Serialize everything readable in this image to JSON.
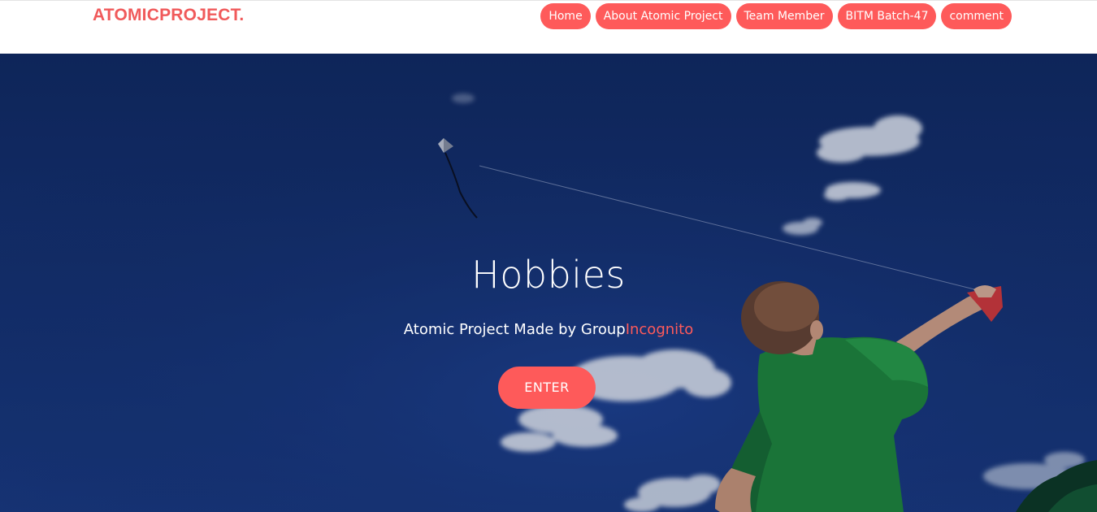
{
  "header": {
    "brand": "ATOMICPROJECT.",
    "nav": [
      {
        "label": "Home"
      },
      {
        "label": "About Atomic Project"
      },
      {
        "label": "Team Member"
      },
      {
        "label": "BITM Batch-47"
      },
      {
        "label": "comment"
      }
    ]
  },
  "hero": {
    "title": "Hobbies",
    "subtitle_prefix": "Atomic Project Made by Group",
    "subtitle_accent": "Incognito",
    "cta_label": "ENTER"
  },
  "colors": {
    "accent": "#fe5a5a",
    "sky": "#163476",
    "shirt": "#1f8a3a"
  }
}
